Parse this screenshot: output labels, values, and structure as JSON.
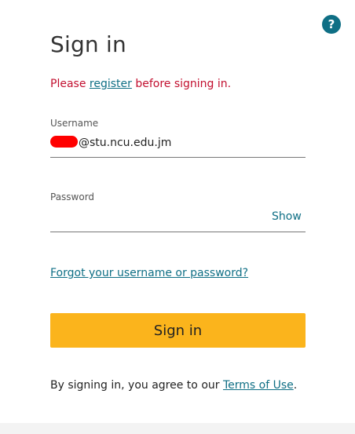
{
  "help": {
    "icon": "help-icon",
    "glyph": "?",
    "color": "#0f6f85"
  },
  "title": "Sign in",
  "notice": {
    "before": "Please ",
    "link": "register",
    "after": " before signing in."
  },
  "username": {
    "label": "Username",
    "value_suffix": "@stu.ncu.edu.jm"
  },
  "password": {
    "label": "Password",
    "show_label": "Show"
  },
  "forgot_link": "Forgot your username or password?",
  "signin_button": "Sign in",
  "terms": {
    "before": "By signing in, you agree to our ",
    "link": "Terms of Use",
    "after": "."
  },
  "colors": {
    "accent": "#0f6f85",
    "button": "#fbb41c",
    "error": "#c20f2f"
  }
}
